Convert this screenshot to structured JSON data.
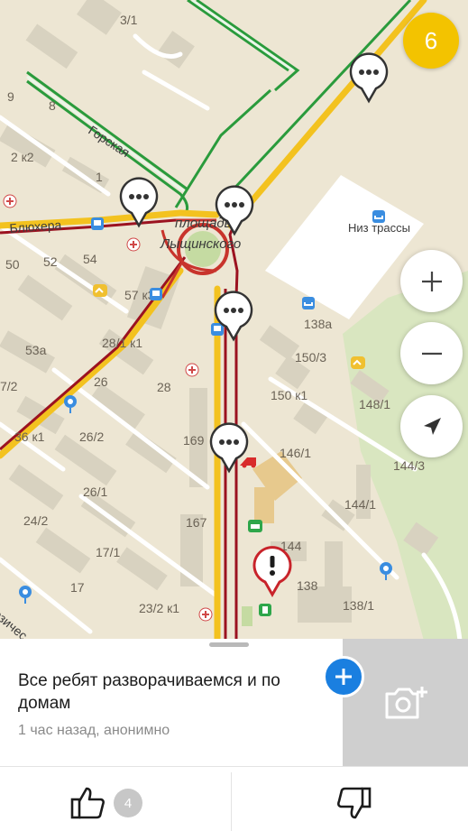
{
  "map": {
    "labels": {
      "l_3_1": "3/1",
      "l_9": "9",
      "l_8": "8",
      "l_gorskaya": "Горская",
      "l_2k2": "2 к2",
      "l_1": "1",
      "l_bluhera": "Блюхера",
      "l_plosh1": "площадь",
      "l_plosh2": "Лыщинского",
      "l_niz": "Низ трассы",
      "l_50": "50",
      "l_52": "52",
      "l_54": "54",
      "l_57k3": "57 к3",
      "l_138a": "138а",
      "l_53a": "53а",
      "l_28_1k1": "28/1 к1",
      "l_150_3": "150/3",
      "l_7_2": "7/2",
      "l_26": "26",
      "l_28": "28",
      "l_150k1": "150 к1",
      "l_148_1": "148/1",
      "l_36k1": "36 к1",
      "l_26_2": "26/2",
      "l_169": "169",
      "l_146_1": "146/1",
      "l_144_3": "144/3",
      "l_26_1": "26/1",
      "l_144_1": "144/1",
      "l_24_2": "24/2",
      "l_167": "167",
      "l_144": "144",
      "l_17_1": "17/1",
      "l_17": "17",
      "l_138": "138",
      "l_138_1": "138/1",
      "l_23_2k1": "23/2 к1",
      "l_ezich": "езичес"
    },
    "event_count": "6"
  },
  "sheet": {
    "message": "Все ребят разворачиваемся и по домам",
    "meta": "1 час назад, анонимно",
    "likes": "4"
  }
}
